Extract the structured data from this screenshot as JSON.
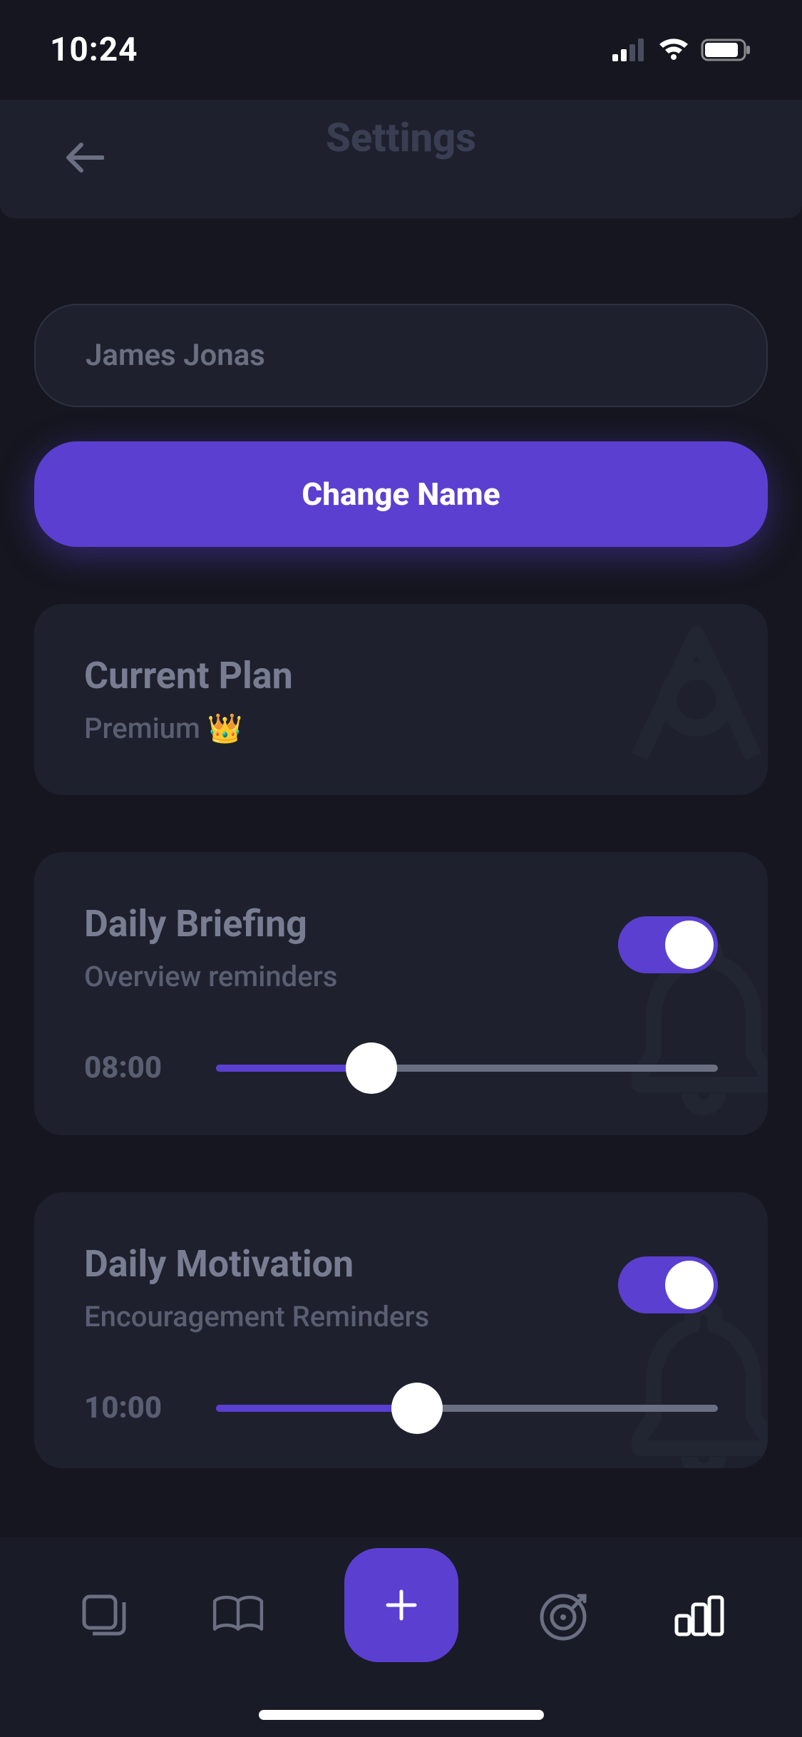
{
  "status": {
    "time": "10:24"
  },
  "header": {
    "title": "Settings"
  },
  "name": {
    "value": "James Jonas",
    "change_label": "Change Name"
  },
  "plan": {
    "title": "Current Plan",
    "value": "Premium 👑"
  },
  "briefing": {
    "title": "Daily Briefing",
    "subtitle": "Overview reminders",
    "time": "08:00",
    "toggle": true,
    "slider_percent": 31
  },
  "motivation": {
    "title": "Daily Motivation",
    "subtitle": "Encouragement Reminders",
    "time": "10:00",
    "toggle": true,
    "slider_percent": 40
  }
}
